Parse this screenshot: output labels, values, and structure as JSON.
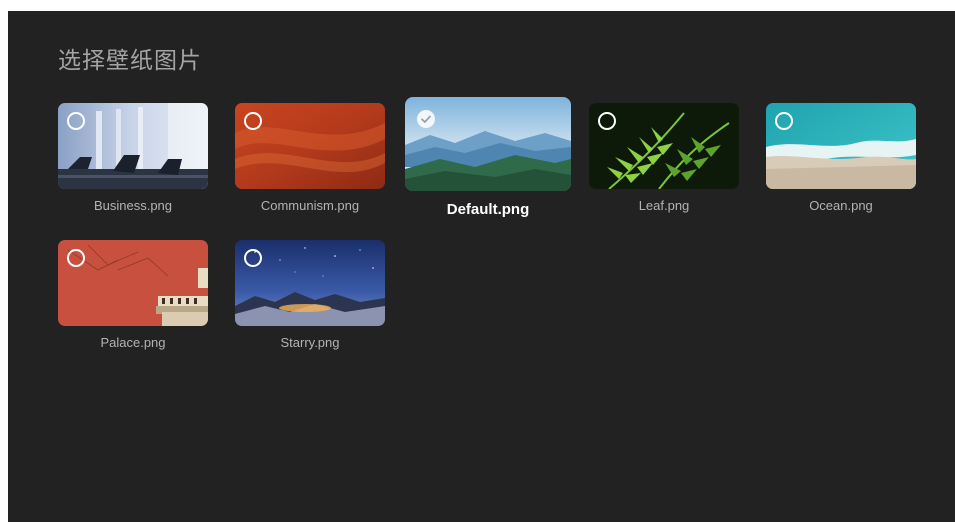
{
  "header": {
    "title": "选择壁纸图片"
  },
  "wallpapers": [
    {
      "label": "Business.png",
      "selected": false,
      "icon": "radio-unchecked-icon"
    },
    {
      "label": "Communism.png",
      "selected": false,
      "icon": "radio-unchecked-icon"
    },
    {
      "label": "Default.png",
      "selected": true,
      "icon": "check-icon"
    },
    {
      "label": "Leaf.png",
      "selected": false,
      "icon": "radio-unchecked-icon"
    },
    {
      "label": "Ocean.png",
      "selected": false,
      "icon": "radio-unchecked-icon"
    },
    {
      "label": "Palace.png",
      "selected": false,
      "icon": "radio-unchecked-icon"
    },
    {
      "label": "Starry.png",
      "selected": false,
      "icon": "radio-unchecked-icon"
    }
  ],
  "colors": {
    "background": "#222222",
    "title": "#a4a4a4",
    "caption": "#b3b3b3",
    "caption_selected": "#ffffff"
  }
}
